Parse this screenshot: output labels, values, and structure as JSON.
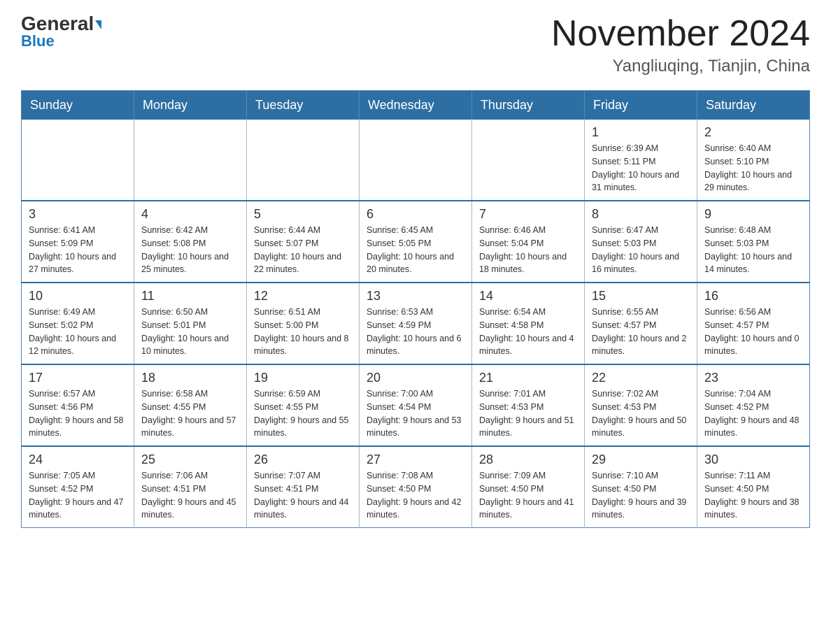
{
  "header": {
    "logo_general": "General",
    "logo_blue": "Blue",
    "month_year": "November 2024",
    "location": "Yangliuqing, Tianjin, China"
  },
  "days_of_week": [
    "Sunday",
    "Monday",
    "Tuesday",
    "Wednesday",
    "Thursday",
    "Friday",
    "Saturday"
  ],
  "weeks": [
    [
      {
        "day": "",
        "info": ""
      },
      {
        "day": "",
        "info": ""
      },
      {
        "day": "",
        "info": ""
      },
      {
        "day": "",
        "info": ""
      },
      {
        "day": "",
        "info": ""
      },
      {
        "day": "1",
        "info": "Sunrise: 6:39 AM\nSunset: 5:11 PM\nDaylight: 10 hours and 31 minutes."
      },
      {
        "day": "2",
        "info": "Sunrise: 6:40 AM\nSunset: 5:10 PM\nDaylight: 10 hours and 29 minutes."
      }
    ],
    [
      {
        "day": "3",
        "info": "Sunrise: 6:41 AM\nSunset: 5:09 PM\nDaylight: 10 hours and 27 minutes."
      },
      {
        "day": "4",
        "info": "Sunrise: 6:42 AM\nSunset: 5:08 PM\nDaylight: 10 hours and 25 minutes."
      },
      {
        "day": "5",
        "info": "Sunrise: 6:44 AM\nSunset: 5:07 PM\nDaylight: 10 hours and 22 minutes."
      },
      {
        "day": "6",
        "info": "Sunrise: 6:45 AM\nSunset: 5:05 PM\nDaylight: 10 hours and 20 minutes."
      },
      {
        "day": "7",
        "info": "Sunrise: 6:46 AM\nSunset: 5:04 PM\nDaylight: 10 hours and 18 minutes."
      },
      {
        "day": "8",
        "info": "Sunrise: 6:47 AM\nSunset: 5:03 PM\nDaylight: 10 hours and 16 minutes."
      },
      {
        "day": "9",
        "info": "Sunrise: 6:48 AM\nSunset: 5:03 PM\nDaylight: 10 hours and 14 minutes."
      }
    ],
    [
      {
        "day": "10",
        "info": "Sunrise: 6:49 AM\nSunset: 5:02 PM\nDaylight: 10 hours and 12 minutes."
      },
      {
        "day": "11",
        "info": "Sunrise: 6:50 AM\nSunset: 5:01 PM\nDaylight: 10 hours and 10 minutes."
      },
      {
        "day": "12",
        "info": "Sunrise: 6:51 AM\nSunset: 5:00 PM\nDaylight: 10 hours and 8 minutes."
      },
      {
        "day": "13",
        "info": "Sunrise: 6:53 AM\nSunset: 4:59 PM\nDaylight: 10 hours and 6 minutes."
      },
      {
        "day": "14",
        "info": "Sunrise: 6:54 AM\nSunset: 4:58 PM\nDaylight: 10 hours and 4 minutes."
      },
      {
        "day": "15",
        "info": "Sunrise: 6:55 AM\nSunset: 4:57 PM\nDaylight: 10 hours and 2 minutes."
      },
      {
        "day": "16",
        "info": "Sunrise: 6:56 AM\nSunset: 4:57 PM\nDaylight: 10 hours and 0 minutes."
      }
    ],
    [
      {
        "day": "17",
        "info": "Sunrise: 6:57 AM\nSunset: 4:56 PM\nDaylight: 9 hours and 58 minutes."
      },
      {
        "day": "18",
        "info": "Sunrise: 6:58 AM\nSunset: 4:55 PM\nDaylight: 9 hours and 57 minutes."
      },
      {
        "day": "19",
        "info": "Sunrise: 6:59 AM\nSunset: 4:55 PM\nDaylight: 9 hours and 55 minutes."
      },
      {
        "day": "20",
        "info": "Sunrise: 7:00 AM\nSunset: 4:54 PM\nDaylight: 9 hours and 53 minutes."
      },
      {
        "day": "21",
        "info": "Sunrise: 7:01 AM\nSunset: 4:53 PM\nDaylight: 9 hours and 51 minutes."
      },
      {
        "day": "22",
        "info": "Sunrise: 7:02 AM\nSunset: 4:53 PM\nDaylight: 9 hours and 50 minutes."
      },
      {
        "day": "23",
        "info": "Sunrise: 7:04 AM\nSunset: 4:52 PM\nDaylight: 9 hours and 48 minutes."
      }
    ],
    [
      {
        "day": "24",
        "info": "Sunrise: 7:05 AM\nSunset: 4:52 PM\nDaylight: 9 hours and 47 minutes."
      },
      {
        "day": "25",
        "info": "Sunrise: 7:06 AM\nSunset: 4:51 PM\nDaylight: 9 hours and 45 minutes."
      },
      {
        "day": "26",
        "info": "Sunrise: 7:07 AM\nSunset: 4:51 PM\nDaylight: 9 hours and 44 minutes."
      },
      {
        "day": "27",
        "info": "Sunrise: 7:08 AM\nSunset: 4:50 PM\nDaylight: 9 hours and 42 minutes."
      },
      {
        "day": "28",
        "info": "Sunrise: 7:09 AM\nSunset: 4:50 PM\nDaylight: 9 hours and 41 minutes."
      },
      {
        "day": "29",
        "info": "Sunrise: 7:10 AM\nSunset: 4:50 PM\nDaylight: 9 hours and 39 minutes."
      },
      {
        "day": "30",
        "info": "Sunrise: 7:11 AM\nSunset: 4:50 PM\nDaylight: 9 hours and 38 minutes."
      }
    ]
  ]
}
